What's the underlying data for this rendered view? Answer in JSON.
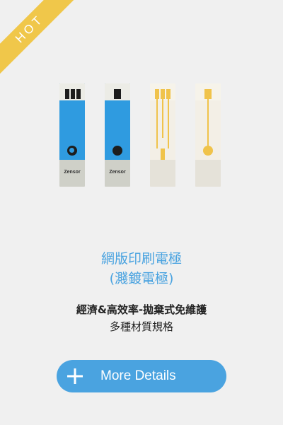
{
  "badge": {
    "label": "HOT",
    "color": "#f0c74a"
  },
  "product": {
    "image_alt": "electrode strips",
    "strip_brand": "Zensor",
    "title_line1": "網版印刷電極",
    "title_line2": "(濺鍍電極)",
    "desc_line1": "經濟&高效率-拋棄式免維護",
    "desc_line2": "多種材質規格",
    "accent_color": "#4aa3e0"
  },
  "actions": {
    "more_details_label": "More Details",
    "more_details_icon": "plus-icon"
  }
}
